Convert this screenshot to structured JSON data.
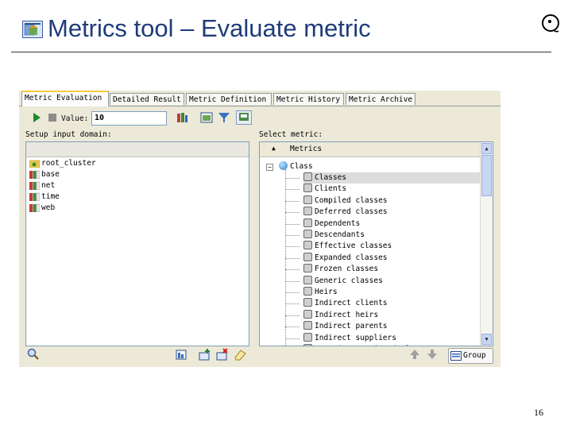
{
  "slide": {
    "title": "Metrics tool – Evaluate metric",
    "page_number": "16"
  },
  "app": {
    "tabs": [
      {
        "label": "Metric Evaluation",
        "active": true
      },
      {
        "label": "Detailed Result",
        "active": false
      },
      {
        "label": "Metric Definition",
        "active": false
      },
      {
        "label": "Metric History",
        "active": false
      },
      {
        "label": "Metric Archive",
        "active": false
      }
    ],
    "toolbar": {
      "value_label": "Value:",
      "value": "10"
    },
    "input_domain": {
      "label": "Setup input domain:",
      "items": [
        "root_cluster",
        "base",
        "net",
        "time",
        "web"
      ]
    },
    "metrics": {
      "label": "Select metric:",
      "column_header": "Metrics",
      "class_node": "Class",
      "items": [
        "Classes",
        "Clients",
        "Compiled classes",
        "Deferred classes",
        "Dependents",
        "Descendants",
        "Effective classes",
        "Expanded classes",
        "Frozen classes",
        "Generic classes",
        "Heirs",
        "Indirect clients",
        "Indirect heirs",
        "Indirect parents",
        "Indirect suppliers",
        "Invariant equipped classes"
      ],
      "selected_index": 0
    },
    "group_button_label": "Group"
  },
  "colors": {
    "title": "#1e3c78",
    "panel_bg": "#ece9d8",
    "active_tab_accent": "#ffc83c"
  }
}
